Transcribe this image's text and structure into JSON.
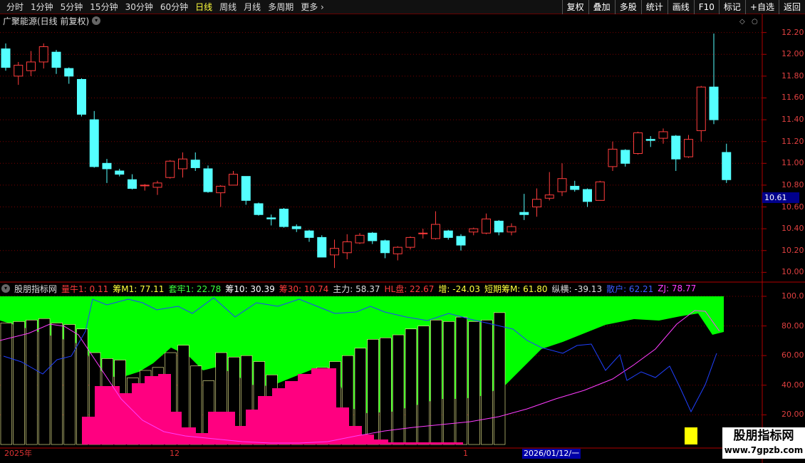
{
  "toolbar": {
    "left": [
      {
        "label": "分时",
        "active": false
      },
      {
        "label": "1分钟",
        "active": false
      },
      {
        "label": "5分钟",
        "active": false
      },
      {
        "label": "15分钟",
        "active": false
      },
      {
        "label": "30分钟",
        "active": false
      },
      {
        "label": "60分钟",
        "active": false
      },
      {
        "label": "日线",
        "active": true
      },
      {
        "label": "周线",
        "active": false
      },
      {
        "label": "月线",
        "active": false
      },
      {
        "label": "多周期",
        "active": false
      },
      {
        "label": "更多",
        "active": false
      }
    ],
    "right": [
      "复权",
      "叠加",
      "多股",
      "统计",
      "画线",
      "F10",
      "标记",
      "+自选",
      "返回"
    ]
  },
  "title": "广聚能源(日线 前复权)",
  "price_axis": [
    "12.20",
    "12.00",
    "11.80",
    "11.60",
    "11.40",
    "11.20",
    "11.00",
    "10.80",
    "10.60",
    "10.40",
    "10.20",
    "10.00"
  ],
  "current_price": "10.61",
  "indicator": {
    "name": "股朋指标网",
    "items": [
      {
        "label": "量牛1: 0.11",
        "color": "#ff3c3c"
      },
      {
        "label": "筹M1: 77.11",
        "color": "#ffff3c"
      },
      {
        "label": "套牢1: 22.78",
        "color": "#3cff3c"
      },
      {
        "label": "筹10: 30.39",
        "color": "#ffffff"
      },
      {
        "label": "筹30: 10.74",
        "color": "#ff3c3c"
      },
      {
        "label": "主力: 58.37",
        "color": "#dddddd"
      },
      {
        "label": "HL盘: 22.67",
        "color": "#ff3c3c"
      },
      {
        "label": "增: -24.03",
        "color": "#ffff3c"
      },
      {
        "label": "短期筹M: 61.80",
        "color": "#ffff3c"
      },
      {
        "label": "纵横: -39.13",
        "color": "#dddddd"
      },
      {
        "label": "散户: 62.21",
        "color": "#3c5aff"
      },
      {
        "label": "ZJ: 78.77",
        "color": "#ff3cff"
      }
    ]
  },
  "ind_axis": [
    "100.0",
    "80.00",
    "60.00",
    "40.00",
    "20.00"
  ],
  "dates": {
    "year": "2025年",
    "month12": "12",
    "month1": "1",
    "cursor": "2026/01/12/一"
  },
  "watermark": {
    "line1": "股朋指标网",
    "line2": "www.7gpzb.com"
  },
  "chart_data": {
    "type": "candlestick",
    "ylim": [
      9.95,
      12.25
    ],
    "candles": [
      [
        12.05,
        11.88,
        12.1,
        11.85
      ],
      [
        11.8,
        11.9,
        11.93,
        11.72
      ],
      [
        11.85,
        11.93,
        12.03,
        11.8
      ],
      [
        11.93,
        12.07,
        12.1,
        11.87
      ],
      [
        12.02,
        11.88,
        12.04,
        11.82
      ],
      [
        11.87,
        11.8,
        11.88,
        11.73
      ],
      [
        11.77,
        11.45,
        11.78,
        11.43
      ],
      [
        11.4,
        10.97,
        11.48,
        10.96
      ],
      [
        11.0,
        10.95,
        11.04,
        10.82
      ],
      [
        10.93,
        10.9,
        10.95,
        10.88
      ],
      [
        10.85,
        10.77,
        10.9,
        10.76
      ],
      [
        10.8,
        10.8,
        10.81,
        10.75
      ],
      [
        10.78,
        10.82,
        10.84,
        10.71
      ],
      [
        10.87,
        11.02,
        11.03,
        10.86
      ],
      [
        10.95,
        11.04,
        11.1,
        10.87
      ],
      [
        11.03,
        10.96,
        11.1,
        10.93
      ],
      [
        10.95,
        10.74,
        10.98,
        10.73
      ],
      [
        10.73,
        10.79,
        10.8,
        10.6
      ],
      [
        10.8,
        10.9,
        10.93,
        10.8
      ],
      [
        10.88,
        10.66,
        10.88,
        10.62
      ],
      [
        10.63,
        10.53,
        10.64,
        10.52
      ],
      [
        10.5,
        10.49,
        10.53,
        10.43
      ],
      [
        10.58,
        10.42,
        10.59,
        10.41
      ],
      [
        10.42,
        10.4,
        10.44,
        10.37
      ],
      [
        10.38,
        10.32,
        10.39,
        10.28
      ],
      [
        10.32,
        10.14,
        10.34,
        10.14
      ],
      [
        10.16,
        10.22,
        10.3,
        10.04
      ],
      [
        10.18,
        10.28,
        10.35,
        10.12
      ],
      [
        10.27,
        10.34,
        10.36,
        10.26
      ],
      [
        10.36,
        10.29,
        10.37,
        10.26
      ],
      [
        10.29,
        10.18,
        10.3,
        10.13
      ],
      [
        10.17,
        10.23,
        10.24,
        10.11
      ],
      [
        10.23,
        10.32,
        10.33,
        10.21
      ],
      [
        10.36,
        10.36,
        10.4,
        10.31
      ],
      [
        10.31,
        10.44,
        10.56,
        10.3
      ],
      [
        10.38,
        10.32,
        10.39,
        10.3
      ],
      [
        10.33,
        10.25,
        10.35,
        10.2
      ],
      [
        10.37,
        10.4,
        10.41,
        10.34
      ],
      [
        10.36,
        10.49,
        10.54,
        10.35
      ],
      [
        10.47,
        10.37,
        10.48,
        10.34
      ],
      [
        10.37,
        10.42,
        10.45,
        10.34
      ],
      [
        10.55,
        10.53,
        10.72,
        10.48
      ],
      [
        10.6,
        10.67,
        10.77,
        10.51
      ],
      [
        10.68,
        10.71,
        10.92,
        10.66
      ],
      [
        10.74,
        10.86,
        11.0,
        10.7
      ],
      [
        10.79,
        10.76,
        10.84,
        10.74
      ],
      [
        10.76,
        10.65,
        10.77,
        10.6
      ],
      [
        10.66,
        10.83,
        10.84,
        10.66
      ],
      [
        10.97,
        11.13,
        11.2,
        10.93
      ],
      [
        11.12,
        11.0,
        11.13,
        10.97
      ],
      [
        11.09,
        11.28,
        11.29,
        11.08
      ],
      [
        11.22,
        11.21,
        11.25,
        11.15
      ],
      [
        11.23,
        11.29,
        11.32,
        11.18
      ],
      [
        11.25,
        11.04,
        11.26,
        10.93
      ],
      [
        11.06,
        11.22,
        11.26,
        11.05
      ],
      [
        11.3,
        11.7,
        11.71,
        11.2
      ],
      [
        11.7,
        11.4,
        12.19,
        11.36
      ],
      [
        11.1,
        10.85,
        11.18,
        10.82
      ]
    ],
    "indicator_bars": [
      82,
      83,
      84,
      85,
      82,
      81,
      78,
      62,
      58,
      57,
      45,
      50,
      52,
      62,
      67,
      53,
      43,
      62,
      59,
      60,
      56,
      47,
      26,
      29,
      34,
      52,
      56,
      60,
      65,
      71,
      72,
      74,
      78,
      80,
      84,
      83,
      86,
      83,
      84,
      89
    ]
  }
}
